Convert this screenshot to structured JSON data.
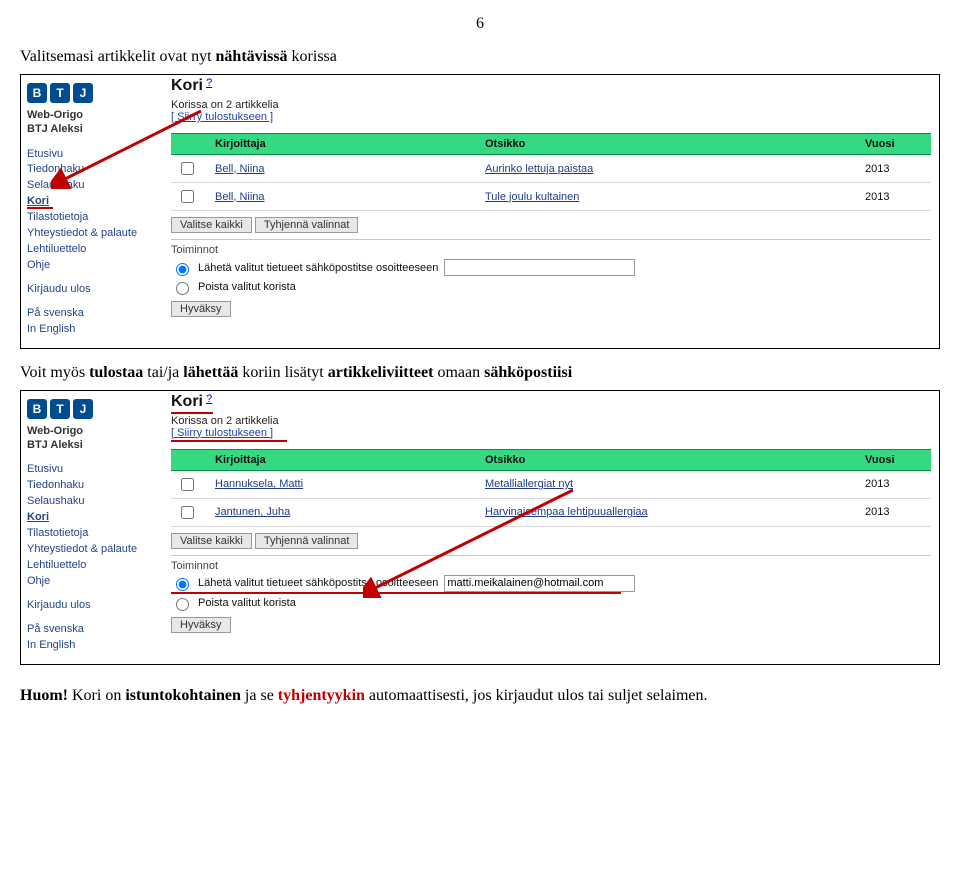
{
  "page_number": "6",
  "intro1_parts": [
    "Valitsemasi artikkelit ovat nyt ",
    "nähtävissä",
    " korissa"
  ],
  "intro2_parts": [
    "Voit myös ",
    "tulostaa",
    " tai/ja ",
    "lähettää",
    " koriin lisätyt ",
    "artikkeliviitteet",
    " omaan ",
    "sähköpostiisi"
  ],
  "footnote_parts": [
    "Huom!",
    " Kori on ",
    "istuntokohtainen",
    " ja se ",
    "tyhjentyykin",
    " automaattisesti, jos kirjaudut ulos tai suljet selaimen."
  ],
  "logo": [
    "B",
    "T",
    "J"
  ],
  "brand": {
    "line1": "Web-Origo",
    "line2": "BTJ Aleksi"
  },
  "nav": {
    "etusivu": "Etusivu",
    "tiedonhaku": "Tiedonhaku",
    "selaushaku": "Selaushaku",
    "kori": "Kori",
    "tilastotietoja": "Tilastotietoja",
    "yhteystiedot": "Yhteystiedot & palaute",
    "lehtiluettelo": "Lehtiluettelo",
    "ohje": "Ohje",
    "kirjaudu": "Kirjaudu ulos",
    "svenska": "På svenska",
    "english": "In English"
  },
  "kori": {
    "title": "Kori",
    "q": "?",
    "count_line": "Korissa on 2 artikkelia",
    "siirry": "[ Siirry tulostukseen ]"
  },
  "headers": {
    "kirjoittaja": "Kirjoittaja",
    "otsikko": "Otsikko",
    "vuosi": "Vuosi"
  },
  "buttons": {
    "valitse": "Valitse kaikki",
    "tyhjenna": "Tyhjennä valinnat",
    "hyvaksy": "Hyväksy"
  },
  "toiminnot": {
    "label": "Toiminnot",
    "send": "Lähetä valitut tietueet sähköpostitse osoitteeseen",
    "remove": "Poista valitut korista"
  },
  "shot1": {
    "rows": [
      {
        "author": "Bell, Niina",
        "title": "Aurinko lettuja paistaa",
        "year": "2013"
      },
      {
        "author": "Bell, Niina",
        "title": "Tule joulu kultainen",
        "year": "2013"
      }
    ],
    "email_value": ""
  },
  "shot2": {
    "rows": [
      {
        "author": "Hannuksela, Matti",
        "title": "Metalliallergiat nyt",
        "year": "2013"
      },
      {
        "author": "Jantunen, Juha",
        "title": "Harvinaisempaa lehtipuuallergiaa",
        "year": "2013"
      }
    ],
    "email_value": "matti.meikalainen@hotmail.com"
  }
}
